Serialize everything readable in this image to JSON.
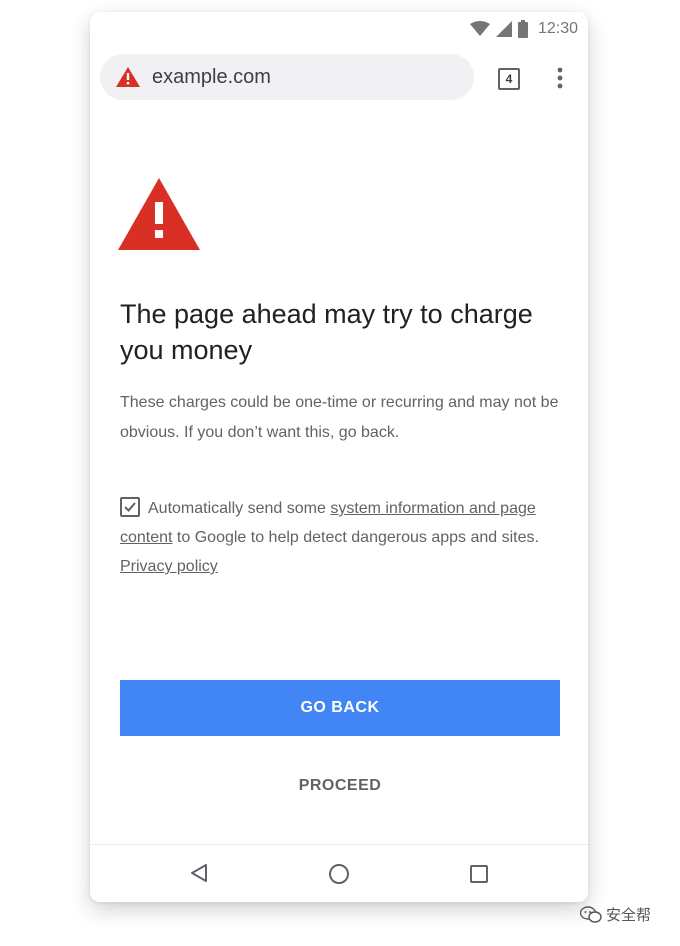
{
  "status_bar": {
    "time": "12:30"
  },
  "toolbar": {
    "url": "example.com",
    "tab_count": "4"
  },
  "interstitial": {
    "title": "The page ahead may try to charge you money",
    "description": "These charges could be one-time or recurring and may not be obvious. If you don’t want this, go back.",
    "consent": {
      "checked": true,
      "text_before": "Automatically send some ",
      "link1": "system information and page content",
      "text_middle": " to Google to help detect dangerous apps and sites. ",
      "link2": "Privacy policy"
    },
    "primary_button": "GO BACK",
    "secondary_button": "PROCEED"
  },
  "watermark": {
    "text": "安全帮"
  },
  "colors": {
    "warning_red": "#d93025",
    "primary_blue": "#4285f4",
    "text_dark": "#202124",
    "text_muted": "#5f6368"
  },
  "icons": [
    "wifi-icon",
    "signal-icon",
    "battery-icon",
    "warning-icon",
    "tab-switcher-icon",
    "more-vert-icon",
    "checkbox-icon",
    "nav-back-icon",
    "nav-home-icon",
    "nav-recents-icon",
    "wechat-icon"
  ]
}
